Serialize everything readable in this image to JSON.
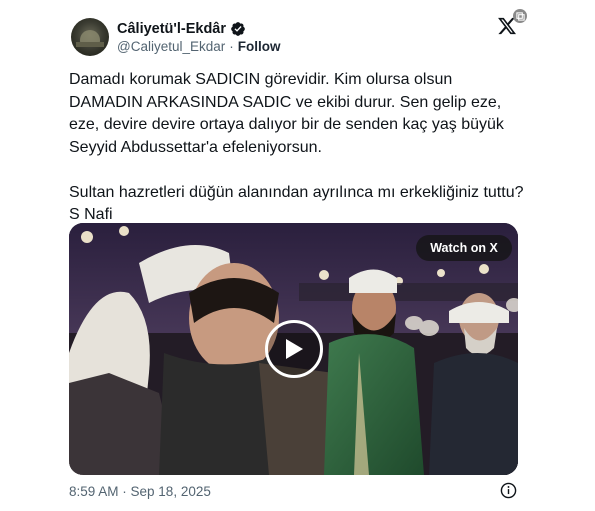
{
  "author": {
    "display_name": "Câliyetü'l-Ekdâr",
    "handle": "@Caliyetul_Ekdar",
    "separator": "·",
    "follow_label": "Follow",
    "verified_icon": "verified-badge-icon",
    "verified_color": "#0f1419"
  },
  "tweet": {
    "text": "Damadı korumak SADICIN görevidir. Kim olursa olsun DAMADIN ARKASINDA SADIC ve ekibi durur. Sen gelip eze, eze, devire devire ortaya dalıyor bir de senden kaç yaş büyük Seyyid Abdussettar'a efeleniyorsun.\n\nSultan hazretleri düğün alanından ayrılınca mı erkekliğiniz tuttu? S Nafi",
    "timestamp": "8:59 AM · Sep 18, 2025"
  },
  "media": {
    "watch_label": "Watch on X",
    "play_icon": "play-icon"
  },
  "icons": {
    "brand": "x-logo-icon",
    "external": "external-link-icon",
    "info": "info-icon"
  },
  "colors": {
    "text": "#0f1419",
    "muted": "#536471",
    "background": "#ffffff"
  }
}
